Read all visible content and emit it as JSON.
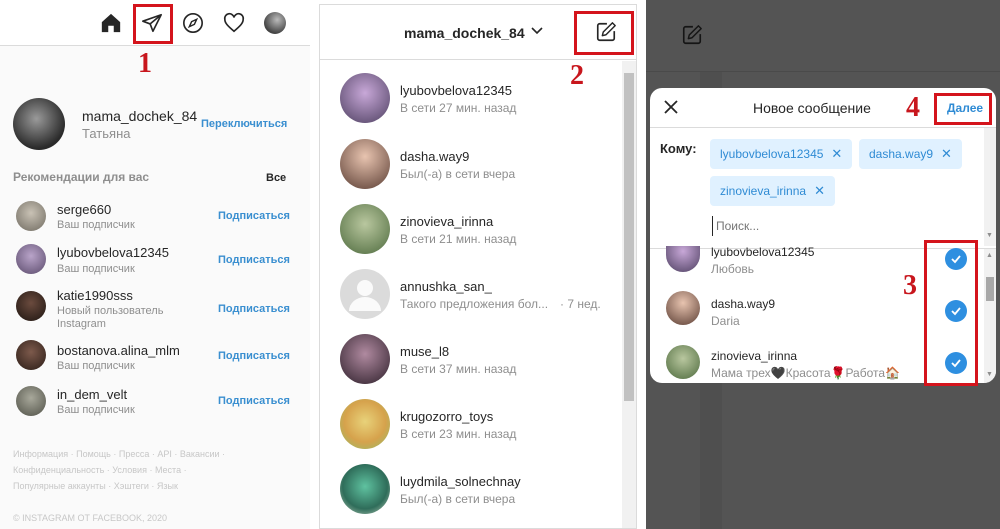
{
  "panel1": {
    "profile": {
      "username": "mama_dochek_84",
      "fullname": "Татьяна",
      "switch_label": "Переключиться"
    },
    "suggestions_title": "Рекомендации для вас",
    "see_all": "Все",
    "suggestions": [
      {
        "username": "serge660",
        "subtitle": "Ваш подписчик",
        "action": "Подписаться"
      },
      {
        "username": "lyubovbelova12345",
        "subtitle": "Ваш подписчик",
        "action": "Подписаться"
      },
      {
        "username": "katie1990sss",
        "subtitle": "Новый пользователь",
        "subtitle2": "Instagram",
        "action": "Подписаться"
      },
      {
        "username": "bostanova.alina_mlm",
        "subtitle": "Ваш подписчик",
        "action": "Подписаться"
      },
      {
        "username": "in_dem_velt",
        "subtitle": "Ваш подписчик",
        "action": "Подписаться"
      }
    ],
    "footer_line1": "Информация · Помощь · Пресса · API · Вакансии ·",
    "footer_line2": "Конфиденциальность · Условия · Места ·",
    "footer_line3": "Популярные аккаунты · Хэштеги · Язык",
    "copyright": "© INSTAGRAM ОТ FACEBOOK, 2020",
    "marker": "1"
  },
  "panel2": {
    "account": "mama_dochek_84",
    "marker": "2",
    "threads": [
      {
        "username": "lyubovbelova12345",
        "status": "В сети 27 мин. назад"
      },
      {
        "username": "dasha.way9",
        "status": "Был(-а) в сети вчера"
      },
      {
        "username": "zinovieva_irinna",
        "status": "В сети 21 мин. назад"
      },
      {
        "username": "annushka_san_",
        "status": "Такого предложения бол...",
        "time": "· 7 нед."
      },
      {
        "username": "muse_l8",
        "status": "В сети 37 мин. назад"
      },
      {
        "username": "krugozorro_toys",
        "status": "В сети 23 мин. назад"
      },
      {
        "username": "luydmila_solnechnay",
        "status": "Был(-а) в сети вчера"
      }
    ]
  },
  "panel3": {
    "title": "Новое сообщение",
    "next_label": "Далее",
    "to_label": "Кому:",
    "chips": [
      "lyubovbelova12345",
      "dasha.way9",
      "zinovieva_irinna"
    ],
    "search_placeholder": "Поиск...",
    "results": [
      {
        "username": "lyubovbelova12345",
        "name": "Любовь"
      },
      {
        "username": "dasha.way9",
        "name": "Daria"
      },
      {
        "username": "zinovieva_irinna",
        "name": "Мама трех🖤Красота🌹Работа🏠"
      }
    ],
    "marker3": "3",
    "marker4": "4"
  }
}
